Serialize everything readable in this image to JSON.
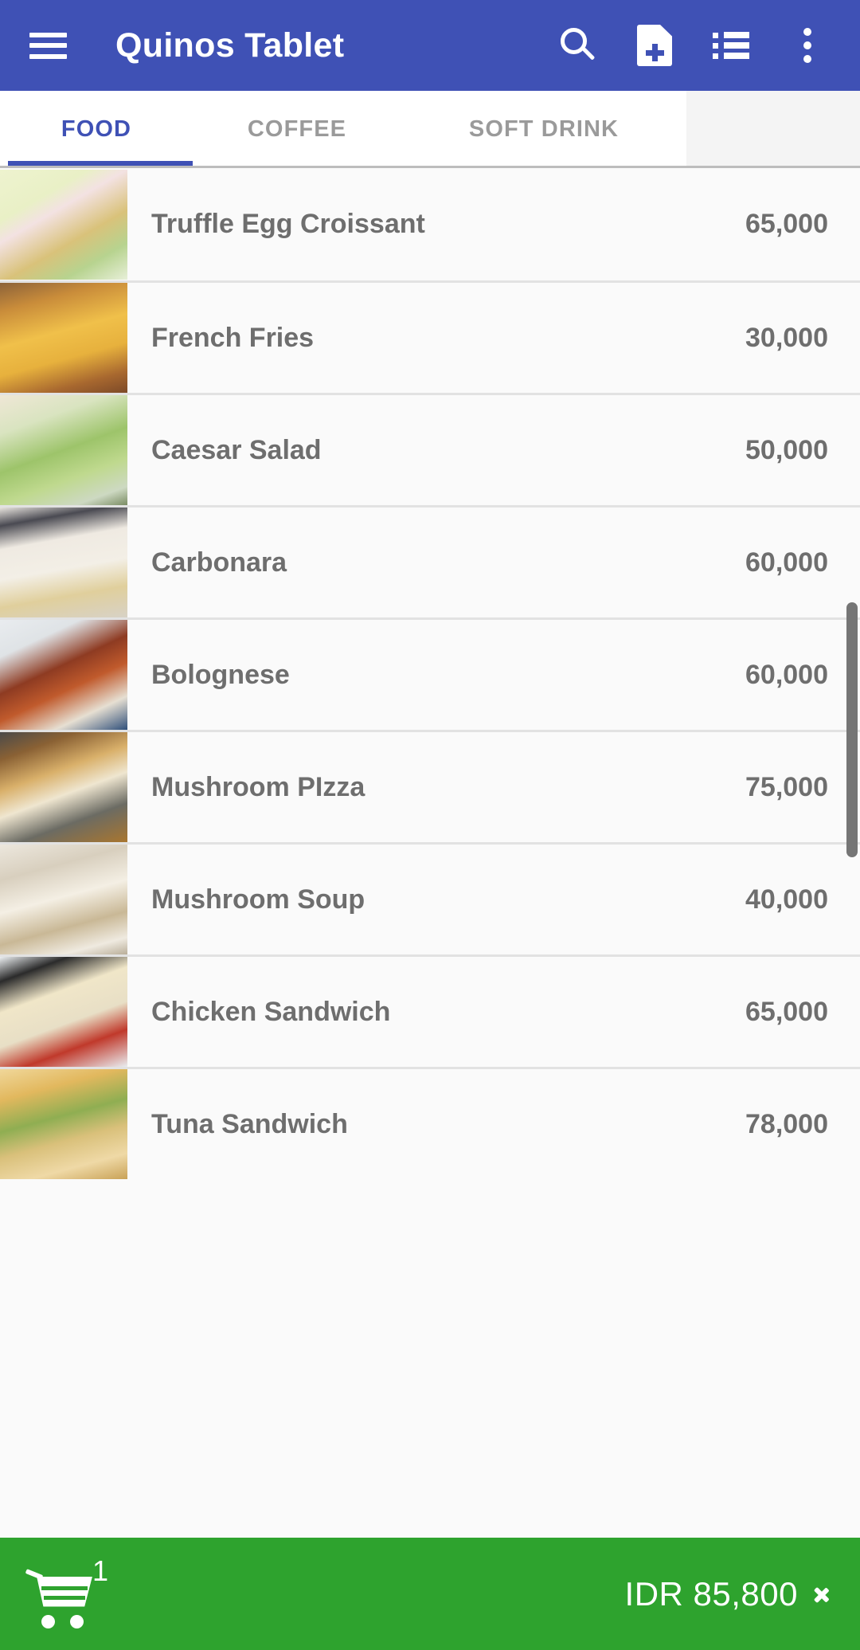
{
  "appbar": {
    "title": "Quinos Tablet",
    "menu_icon": "hamburger-menu-icon",
    "actions": [
      {
        "name": "search-icon",
        "label": "Search"
      },
      {
        "name": "note-add-icon",
        "label": "New Note"
      },
      {
        "name": "list-icon",
        "label": "Order List"
      },
      {
        "name": "overflow-menu-icon",
        "label": "More options"
      }
    ],
    "background_color": "#3f51b5"
  },
  "tabs": {
    "items": [
      {
        "label": "FOOD",
        "active": true
      },
      {
        "label": "COFFEE",
        "active": false
      },
      {
        "label": "SOFT DRINK",
        "active": false
      }
    ],
    "active_color": "#3f51b5",
    "inactive_color": "#9a9a9a"
  },
  "menu": {
    "items": [
      {
        "name": "Truffle Egg Croissant",
        "price": "65,000",
        "thumb": "croissant-salad-photo"
      },
      {
        "name": "French Fries",
        "price": "30,000",
        "thumb": "french-fries-photo"
      },
      {
        "name": "Caesar Salad",
        "price": "50,000",
        "thumb": "caesar-salad-photo"
      },
      {
        "name": "Carbonara",
        "price": "60,000",
        "thumb": "carbonara-pasta-photo"
      },
      {
        "name": "Bolognese",
        "price": "60,000",
        "thumb": "bolognese-pasta-photo"
      },
      {
        "name": "Mushroom PIzza",
        "price": "75,000",
        "thumb": "mushroom-pizza-photo"
      },
      {
        "name": "Mushroom Soup",
        "price": "40,000",
        "thumb": "mushroom-soup-photo"
      },
      {
        "name": "Chicken Sandwich",
        "price": "65,000",
        "thumb": "chicken-sandwich-photo"
      },
      {
        "name": "Tuna Sandwich",
        "price": "78,000",
        "thumb": "tuna-sandwich-photo"
      }
    ]
  },
  "cart": {
    "icon": "shopping-cart-icon",
    "count": "1",
    "total": "IDR 85,800",
    "chevron": "chevron-right-icon",
    "background_color": "#2ea32e"
  }
}
